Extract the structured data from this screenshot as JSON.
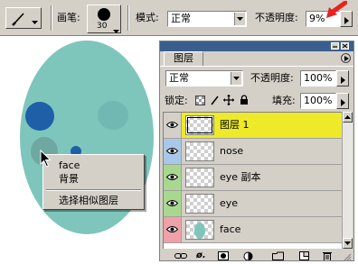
{
  "options_bar": {
    "brush_label": "画笔:",
    "brush_size": "30",
    "mode_label": "模式:",
    "mode_value": "正常",
    "opacity_label": "不透明度:",
    "opacity_value": "9%"
  },
  "canvas": {
    "context_menu": {
      "items": [
        "face",
        "背景",
        "选择相似图层"
      ]
    }
  },
  "layers_panel": {
    "tab_label": "图层",
    "blend_mode": "正常",
    "opacity_label": "不透明度:",
    "opacity_value": "100%",
    "lock_label": "锁定:",
    "fill_label": "填充:",
    "fill_value": "100%",
    "layers": [
      {
        "name": "图层 1",
        "eye_color": "#d4d0c8",
        "selected": true
      },
      {
        "name": "nose",
        "eye_color": "#a8c8e8",
        "selected": false
      },
      {
        "name": "eye 副本",
        "eye_color": "#a8d890",
        "selected": false
      },
      {
        "name": "eye",
        "eye_color": "#a8d890",
        "selected": false
      },
      {
        "name": "face",
        "eye_color": "#f0a0a8",
        "selected": false
      }
    ]
  },
  "colors": {
    "canvas_oval": "#7ec6bc",
    "selected_layer": "#eeea2a",
    "annotation_arrow": "#e8231e",
    "panel_header": "#3a5f8f"
  }
}
